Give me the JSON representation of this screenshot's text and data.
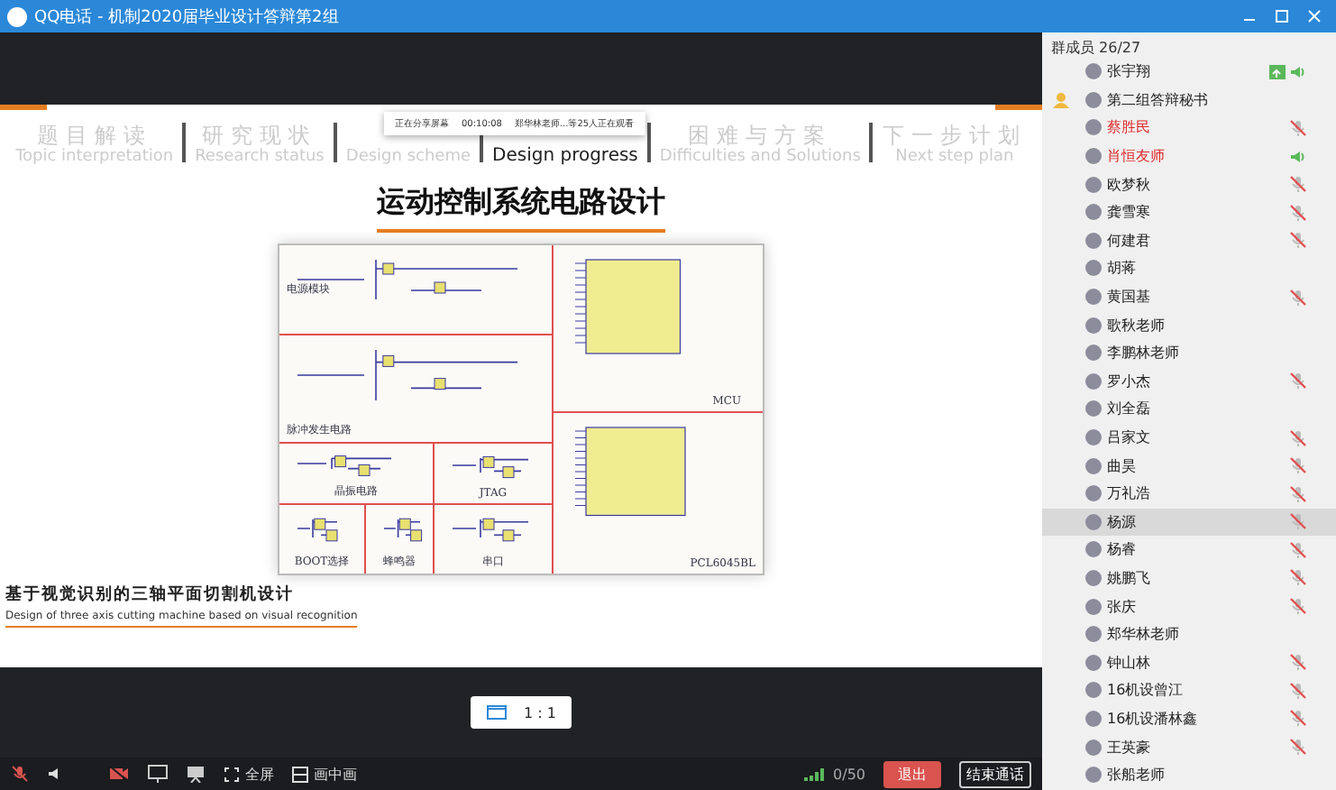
{
  "window": {
    "title": "QQ电话 - 机制2020届毕业设计答辩第2组"
  },
  "share_banner": {
    "status": "正在分享屏幕",
    "time": "00:10:08",
    "viewers": "郑华林老师...等25人正在观看"
  },
  "slide": {
    "nav": [
      {
        "zh": "题目解读",
        "en": "Topic interpretation",
        "selected": false
      },
      {
        "zh": "研究现状",
        "en": "Research status",
        "selected": false
      },
      {
        "en": "Design scheme",
        "selected": false
      },
      {
        "en": "Design progress",
        "selected": true
      },
      {
        "zh": "困难与方案",
        "en": "Difficulties and Solutions",
        "selected": false
      },
      {
        "zh": "下一步计划",
        "en": "Next step plan",
        "selected": false
      }
    ],
    "heading": "运动控制系统电路设计",
    "schematic": {
      "power": "电源模块",
      "pulse": "脉冲发生电路",
      "crystal": "晶振电路",
      "jtag": "JTAG",
      "boot": "BOOT选择",
      "buzzer": "蜂鸣器",
      "serial": "串口",
      "mcu": "MCU",
      "chip": "PCL6045BL"
    },
    "project_zh": "基于视觉识别的三轴平面切割机设计",
    "project_en": "Design of three axis cutting machine based on visual recognition"
  },
  "zoom_badge": "1 : 1",
  "toolbar": {
    "fullscreen": "全屏",
    "pip": "画中画",
    "bitrate": "0/50",
    "exit": "退出",
    "end": "结束通话"
  },
  "members": {
    "header": "群成员 26/27",
    "items": [
      {
        "name": "张宇翔",
        "muted": false,
        "speaking": true,
        "sharing": true,
        "host": false,
        "color": "#222222",
        "selected": false
      },
      {
        "name": "第二组答辩秘书",
        "muted": false,
        "speaking": false,
        "sharing": false,
        "host": true,
        "color": "#222222",
        "selected": false
      },
      {
        "name": "蔡胜民",
        "muted": true,
        "speaking": false,
        "sharing": false,
        "host": false,
        "color": "#e02a2a",
        "selected": false
      },
      {
        "name": "肖恒友师",
        "muted": false,
        "speaking": true,
        "sharing": false,
        "host": false,
        "color": "#e02a2a",
        "selected": false
      },
      {
        "name": "欧梦秋",
        "muted": true,
        "speaking": false,
        "sharing": false,
        "host": false,
        "color": "#222222",
        "selected": false
      },
      {
        "name": "龚雪寒",
        "muted": true,
        "speaking": false,
        "sharing": false,
        "host": false,
        "color": "#222222",
        "selected": false
      },
      {
        "name": "何建君",
        "muted": true,
        "speaking": false,
        "sharing": false,
        "host": false,
        "color": "#222222",
        "selected": false
      },
      {
        "name": "胡蒋",
        "muted": false,
        "speaking": false,
        "sharing": false,
        "host": false,
        "color": "#222222",
        "selected": false
      },
      {
        "name": "黄国基",
        "muted": true,
        "speaking": false,
        "sharing": false,
        "host": false,
        "color": "#222222",
        "selected": false
      },
      {
        "name": "歌秋老师",
        "muted": false,
        "speaking": false,
        "sharing": false,
        "host": false,
        "color": "#222222",
        "selected": false
      },
      {
        "name": "李鹏林老师",
        "muted": false,
        "speaking": false,
        "sharing": false,
        "host": false,
        "color": "#222222",
        "selected": false
      },
      {
        "name": "罗小杰",
        "muted": true,
        "speaking": false,
        "sharing": false,
        "host": false,
        "color": "#222222",
        "selected": false
      },
      {
        "name": "刘全磊",
        "muted": false,
        "speaking": false,
        "sharing": false,
        "host": false,
        "color": "#222222",
        "selected": false
      },
      {
        "name": "吕家文",
        "muted": true,
        "speaking": false,
        "sharing": false,
        "host": false,
        "color": "#222222",
        "selected": false
      },
      {
        "name": "曲昊",
        "muted": true,
        "speaking": false,
        "sharing": false,
        "host": false,
        "color": "#222222",
        "selected": false
      },
      {
        "name": "万礼浩",
        "muted": true,
        "speaking": false,
        "sharing": false,
        "host": false,
        "color": "#222222",
        "selected": false
      },
      {
        "name": "杨源",
        "muted": true,
        "speaking": false,
        "sharing": false,
        "host": false,
        "color": "#222222",
        "selected": true
      },
      {
        "name": "杨睿",
        "muted": true,
        "speaking": false,
        "sharing": false,
        "host": false,
        "color": "#222222",
        "selected": false
      },
      {
        "name": "姚鹏飞",
        "muted": true,
        "speaking": false,
        "sharing": false,
        "host": false,
        "color": "#222222",
        "selected": false
      },
      {
        "name": "张庆",
        "muted": true,
        "speaking": false,
        "sharing": false,
        "host": false,
        "color": "#222222",
        "selected": false
      },
      {
        "name": "郑华林老师",
        "muted": false,
        "speaking": false,
        "sharing": false,
        "host": false,
        "color": "#222222",
        "selected": false
      },
      {
        "name": "钟山林",
        "muted": true,
        "speaking": false,
        "sharing": false,
        "host": false,
        "color": "#222222",
        "selected": false
      },
      {
        "name": "16机设曾江",
        "muted": true,
        "speaking": false,
        "sharing": false,
        "host": false,
        "color": "#222222",
        "selected": false
      },
      {
        "name": "16机设潘林鑫",
        "muted": true,
        "speaking": false,
        "sharing": false,
        "host": false,
        "color": "#222222",
        "selected": false
      },
      {
        "name": "王英豪",
        "muted": true,
        "speaking": false,
        "sharing": false,
        "host": false,
        "color": "#222222",
        "selected": false
      },
      {
        "name": "张船老师",
        "muted": false,
        "speaking": false,
        "sharing": false,
        "host": false,
        "color": "#222222",
        "selected": false
      }
    ]
  }
}
